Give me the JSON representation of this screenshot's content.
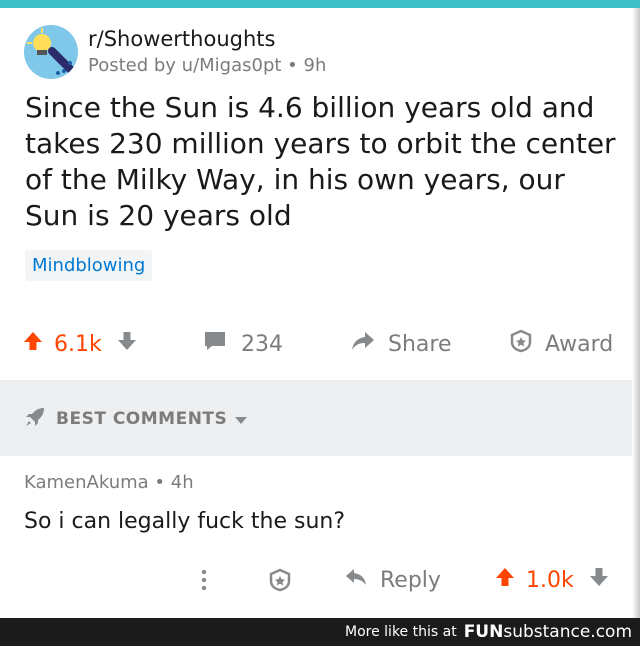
{
  "post": {
    "subreddit": "r/Showerthoughts",
    "posted_by": "Posted by u/Migas0pt • 9h",
    "title": "Since the Sun is 4.6 billion years old and takes 230 million years to orbit the center of the Milky Way, in his own years, our Sun is 20 years old",
    "flair": "Mindblowing"
  },
  "actions": {
    "upvotes": "6.1k",
    "comments": "234",
    "share": "Share",
    "award": "Award"
  },
  "comments_section": {
    "sort_label": "BEST COMMENTS"
  },
  "comment": {
    "author": "KamenAkuma • 4h",
    "body": "So i can legally fuck the sun?",
    "reply": "Reply",
    "votes": "1.0k"
  },
  "footer": {
    "more": "More like this at",
    "brand_bold": "FUN",
    "brand_rest": "substance.com"
  },
  "colors": {
    "upvote": "#ff4500",
    "flair_text": "#0079d3",
    "top_strip": "#3ec1c9",
    "muted": "#7c7c7c"
  },
  "icons": {
    "avatar": "showerthoughts-lightbulb-icon",
    "upvote": "arrow-up-icon",
    "downvote": "arrow-down-icon",
    "comments": "chat-bubble-icon",
    "share": "share-arrow-icon",
    "award": "award-icon",
    "sort": "rocket-icon",
    "more": "kebab-icon",
    "reply": "reply-arrow-icon"
  }
}
